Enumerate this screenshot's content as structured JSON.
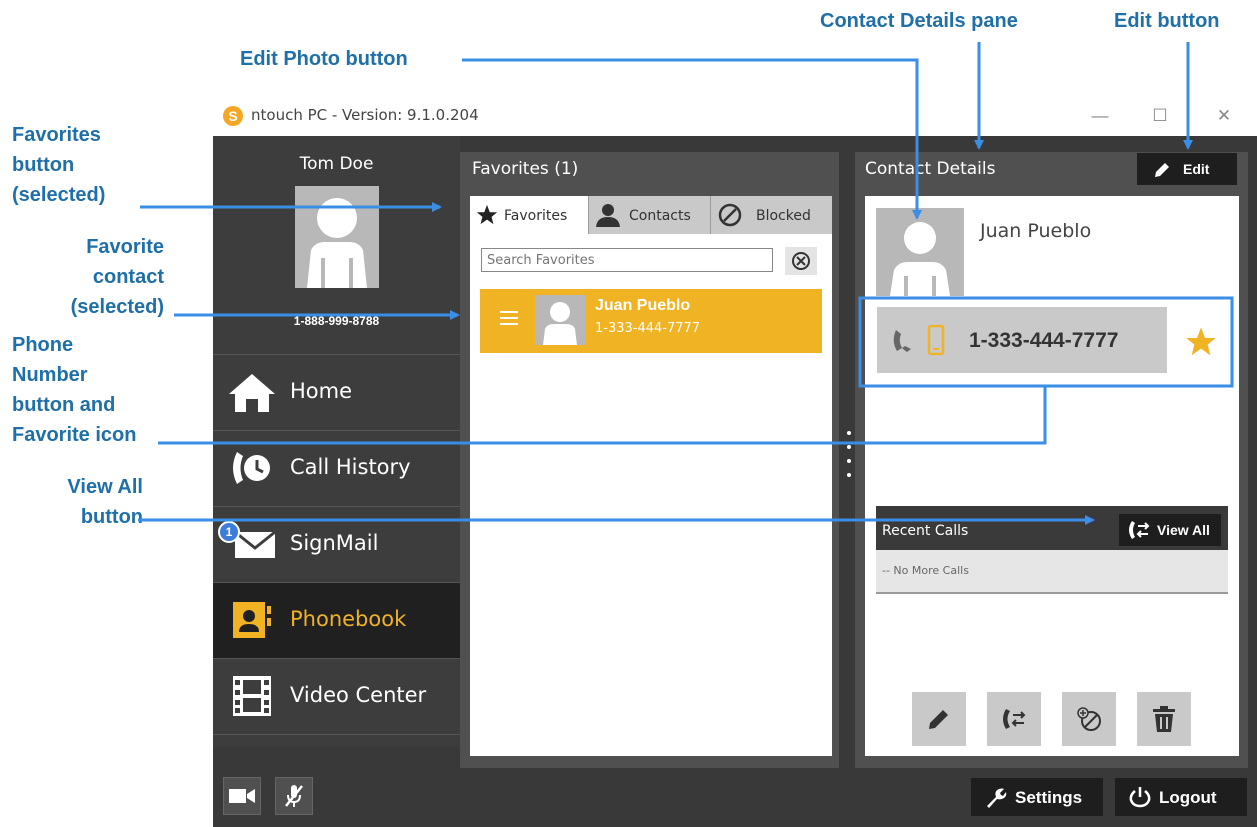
{
  "callouts": {
    "edit_photo": "Edit Photo button",
    "contact_details": "Contact Details pane",
    "edit_button": "Edit button",
    "favorites_button": [
      "Favorites",
      "button",
      "(selected)"
    ],
    "favorite_contact": [
      "Favorite",
      "contact",
      "(selected)"
    ],
    "phone_number": [
      "Phone",
      "Number",
      "button and",
      "Favorite icon"
    ],
    "view_all": [
      "View All",
      "button"
    ]
  },
  "window": {
    "title": "ntouch PC  -  Version:  9.1.0.204",
    "logo_letter": "S",
    "controls": {
      "minimize": "—",
      "maximize": "☐",
      "close": "✕"
    }
  },
  "user": {
    "name": "Tom Doe",
    "phone": "1-888-999-8788"
  },
  "nav": {
    "items": [
      {
        "label": "Home",
        "icon": "home-icon"
      },
      {
        "label": "Call History",
        "icon": "call-history-icon"
      },
      {
        "label": "SignMail",
        "icon": "envelope-icon",
        "badge": "1"
      },
      {
        "label": "Phonebook",
        "icon": "phonebook-icon",
        "selected": true
      },
      {
        "label": "Video Center",
        "icon": "film-icon"
      }
    ]
  },
  "favorites": {
    "title": "Favorites (1)",
    "tabs": [
      {
        "label": "Favorites",
        "icon": "star-icon",
        "selected": true
      },
      {
        "label": "Contacts",
        "icon": "contacts-icon"
      },
      {
        "label": "Blocked",
        "icon": "blocked-icon"
      }
    ],
    "search_placeholder": "Search Favorites",
    "rows": [
      {
        "name": "Juan Pueblo",
        "phone": "1-333-444-7777"
      }
    ]
  },
  "contact_details": {
    "title": "Contact Details",
    "edit_label": "Edit",
    "name": "Juan Pueblo",
    "phone": "1-333-444-7777",
    "recent_calls_title": "Recent Calls",
    "view_all_label": "View All",
    "no_calls": "-- No More Calls"
  },
  "bottom": {
    "settings_label": "Settings",
    "logout_label": "Logout"
  },
  "colors": {
    "accent": "#f0b323",
    "callout": "#1f6fa8",
    "arrow": "#3a8ee6",
    "dark_bg": "#393939"
  }
}
